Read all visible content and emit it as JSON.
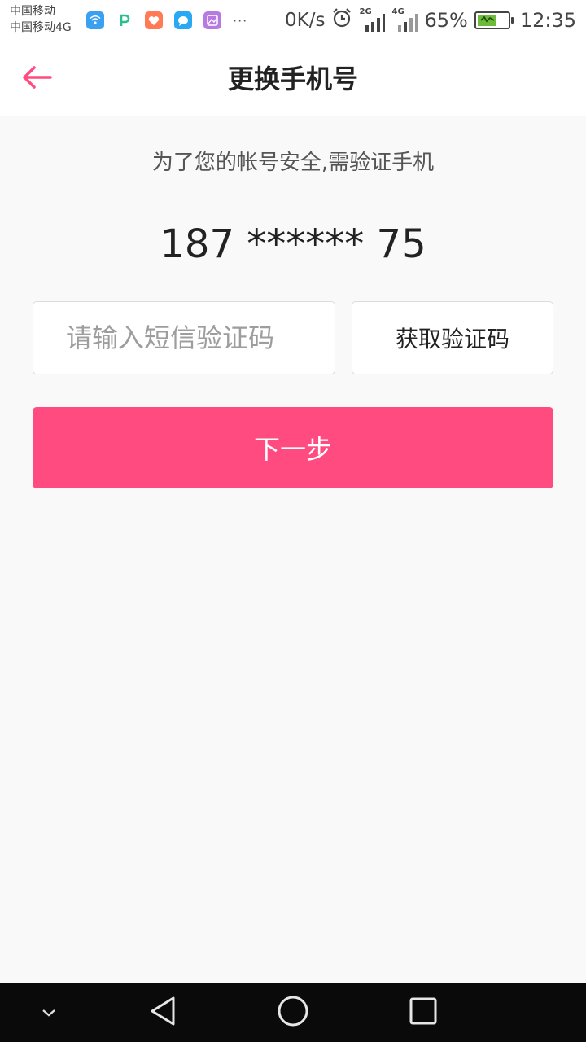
{
  "status_bar": {
    "carrier_1": "中国移动",
    "carrier_2": "中国移动4G",
    "more": "···",
    "net_speed": "0K/s",
    "sim1_tag": "2G",
    "sim2_tag": "4G",
    "battery_percent": "65%",
    "battery_level": 0.65,
    "time": "12:35",
    "notification_icons": [
      "wifi-app-icon",
      "p-app-icon",
      "heart-app-icon",
      "chat-app-icon",
      "gallery-app-icon"
    ]
  },
  "header": {
    "title": "更换手机号",
    "back_icon": "arrow-left-icon"
  },
  "main": {
    "hint": "为了您的帐号安全,需验证手机",
    "phone_masked": "187 ****** 75",
    "code_input_placeholder": "请输入短信验证码",
    "code_input_value": "",
    "get_code_label": "获取验证码",
    "next_label": "下一步"
  },
  "nav_bar": {
    "icons": [
      "chevron-down-icon",
      "back-triangle-icon",
      "home-circle-icon",
      "recents-square-icon"
    ]
  },
  "colors": {
    "accent": "#ff4b80",
    "background": "#f9f9f9",
    "navbar": "#0a0a0a"
  }
}
